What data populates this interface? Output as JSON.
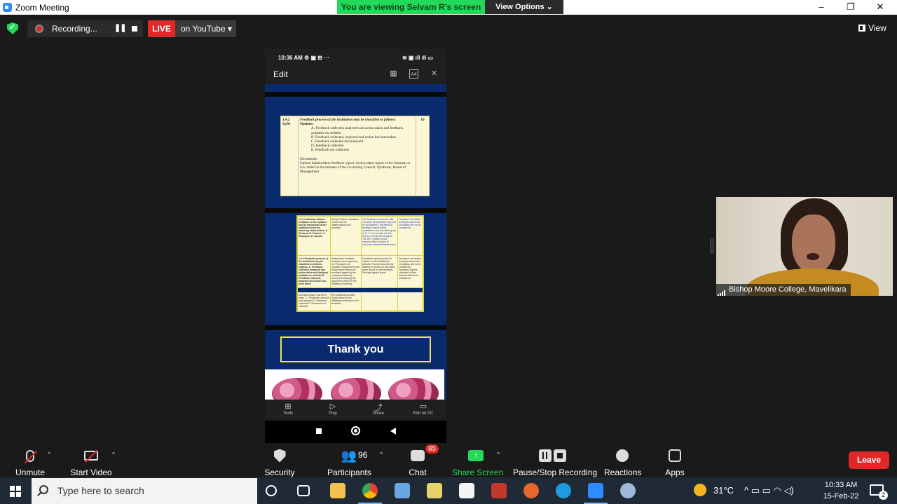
{
  "titlebar": {
    "title": "Zoom Meeting",
    "minimize": "–",
    "restore": "❐",
    "close": "✕"
  },
  "banner": {
    "viewing_text": "You are viewing Selvam R's screen",
    "view_options_label": "View Options ⌄"
  },
  "status": {
    "recording_label": "Recording...",
    "pause_glyph": "❚❚",
    "live_label": "LIVE",
    "stream_label": "on YouTube ▾",
    "view_label": "View"
  },
  "phone": {
    "time": "10:36 AM ⚙ ▣ ⊞ ···",
    "signal_icons": "≋ ▣ ıll ıll ▭",
    "edit_label": "Edit",
    "icons": [
      "grid-icon",
      "aa-icon",
      "close-icon"
    ],
    "icon_glyphs": [
      "▦",
      "A4",
      "✕"
    ],
    "slide1": {
      "code": "1.4.2",
      "type": "QₙM",
      "marks": "10",
      "heading": "Feedback process of the Institution may be classified as follows:",
      "options_label": "Options:",
      "options": [
        "A.  Feedback collected, analysed and action taken and feedback available on website",
        "B.  Feedback collected, analysed and action has been taken",
        "C.  Feedback collected and analysed",
        "D.  Feedback collected",
        "E.  Feedback not collected"
      ],
      "documents_label": "Documents:",
      "documents_text": "Upload Stakeholders feedback report, Action taken report of the institute on it as stated in the minutes of the Governing Council, Syndicate, Board of Management"
    },
    "slide2": {
      "row1": [
        "1.4.1 Institution obtains feedback on the syllabus and its transaction at the institution from the following stakeholders: A. Students B. Teachers C. Employers D. Alumni",
        "Sample Filled in feedback forms from the stakeholders to be provided.",
        "The feedback concerned with curricular development only can be considered. Only filled-up feedback report will be considered. Any one filled up by A, B, C or D provide the link Survey Format with Analysis. The DVV preferred only scanned filled-in forms of randomly selected stakeholders",
        "Feedback not related to design and review of syllabus will not be considered"
      ],
      "row2": [
        "1.4.2 Feedback process of the Institution may be classified as follows: Options: A. Feedback collected, analysed and action taken and feedback available on website B. Feedback collected, analysed and action has been taken",
        "Stakeholder feedback analysis report signed by the Principal to be provided. Department wise Action taken Report on feedback signed by the competent authority. Document showing the placement of ATR in the Affiliating University",
        "Feedback reports should be hosted on the institutional website. Provide links directly leading to reports on the Action taken report on the feedback. Principal signed report",
        "Feedback not related to design and review of syllabus will not be considered. Feedback reports collected in filled website will not be considered"
      ],
      "row3": [
        "and action taken has been taken. C. Feedback collected and analysed D. Feedback collected E. Feedback not collected",
        "the feedback provided. Action taken by the affiliating university on the feedback",
        "",
        ""
      ]
    },
    "thank_you": "Thank you",
    "bottom_items": [
      {
        "glyph": "⊞",
        "label": "Tools"
      },
      {
        "glyph": "▷",
        "label": "Play"
      },
      {
        "glyph": "⤴",
        "label": "Share"
      },
      {
        "glyph": "▭",
        "label": "Edit on PC"
      }
    ]
  },
  "participant": {
    "name": "Bishop Moore College, Mavelikara"
  },
  "toolbar": {
    "unmute": "Unmute",
    "start_video": "Start Video",
    "security": "Security",
    "participants": "Participants",
    "participants_count": "96",
    "chat": "Chat",
    "chat_badge": "85",
    "share_screen": "Share Screen",
    "pause_stop_recording": "Pause/Stop Recording",
    "reactions": "Reactions",
    "apps": "Apps",
    "leave": "Leave",
    "caret": "^",
    "people_glyph": "👥",
    "share_glyph": "↑"
  },
  "taskbar": {
    "search_placeholder": "Type here to search",
    "weather": "31°C",
    "time": "10:33 AM",
    "date": "15-Feb-22",
    "notifications": "2",
    "tray_icons": "^ ▭ ▭ ◠ ◁)"
  },
  "colors": {
    "zoom_green": "#23d959",
    "live_red": "#e02828",
    "zoom_blue": "#2d8cff",
    "taskbar": "#1f2a36"
  }
}
